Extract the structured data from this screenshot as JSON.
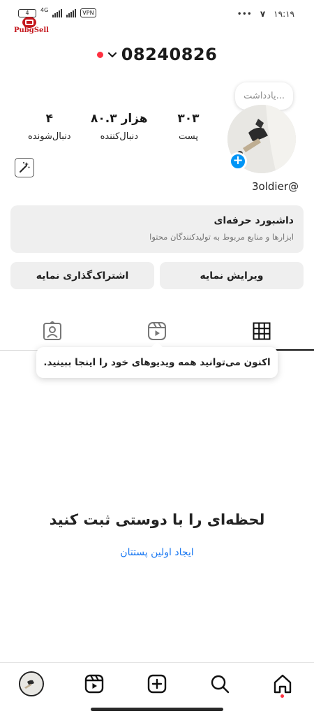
{
  "status_bar": {
    "battery": "4",
    "network": "4G",
    "vpn": "VPN",
    "time": "۱۹:۱۹",
    "signal_text": "۷",
    "dots": "•••"
  },
  "watermark": "PubgSell",
  "header": {
    "account_number": "08240826"
  },
  "profile": {
    "note_placeholder": "یادداشت...",
    "add_story": "+",
    "username": "3oldier@",
    "stats": [
      {
        "value": "۳۰۳",
        "label": "پست"
      },
      {
        "value": "۸۰.۳ هزار",
        "label": "دنبال‌کننده"
      },
      {
        "value": "۴",
        "label": "دنبال‌شونده"
      }
    ]
  },
  "dashboard": {
    "title": "داشبورد حرفه‌ای",
    "subtitle": "ابزارها و منابع مربوط به تولیدکنندگان محتوا"
  },
  "actions": {
    "edit_profile": "ویرایش نمایه",
    "share_profile": "اشتراک‌گذاری نمایه"
  },
  "tooltip": "اکنون می‌توانید همه ویدیوهای خود را اینجا ببینید.",
  "empty_state": {
    "title": "لحظه‌ای را با دوستی ثبت کنید",
    "link": "ایجاد اولین پستتان"
  },
  "colors": {
    "accent": "#0095f6",
    "link": "#1877f2",
    "notification_red": "#ff3040",
    "card_bg": "#efefef"
  },
  "icons": {
    "tabs": [
      "grid-icon",
      "reels-icon",
      "tagged-icon"
    ],
    "nav": [
      "home-icon",
      "search-icon",
      "create-icon",
      "reels-icon",
      "profile-avatar"
    ]
  }
}
